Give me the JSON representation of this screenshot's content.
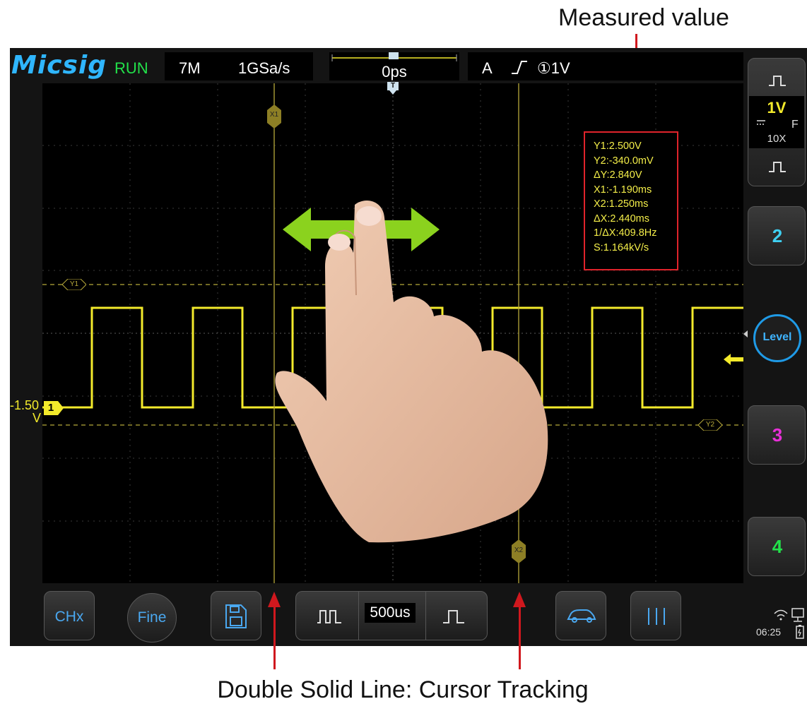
{
  "annotations": {
    "top": "Measured value",
    "bottom": "Double Solid Line: Cursor Tracking"
  },
  "topbar": {
    "brand": "Micsig",
    "run_state": "RUN",
    "memory_depth": "7M",
    "sample_rate": "1GSa/s",
    "time_position": "0ps",
    "trigger_marker": "T",
    "trigger_source": "A",
    "trigger_channel_level": "①1V"
  },
  "cursors": {
    "x1_label": "X1",
    "x2_label": "X2",
    "y1_label": "Y1",
    "y2_label": "Y2"
  },
  "measurements": [
    "Y1:2.500V",
    "Y2:-340.0mV",
    "ΔY:2.840V",
    "X1:-1.190ms",
    "X2:1.250ms",
    "ΔX:2.440ms",
    "1/ΔX:409.8Hz",
    "S:1.164kV/s"
  ],
  "channel1": {
    "number": "1",
    "volts_per_div": "1V",
    "probe": "10X",
    "coupling": "F",
    "offset_line1": "-1.50",
    "offset_line2": "V",
    "color": "#f3ea2b"
  },
  "side_panel": {
    "ch2": "2",
    "ch3": "3",
    "ch4": "4",
    "level": "Level",
    "ch2_color": "#3fd0f2",
    "ch3_color": "#e830d8",
    "ch4_color": "#22e14a"
  },
  "bottombar": {
    "chx": "CHx",
    "fine": "Fine",
    "timebase": "500us",
    "clock": "06:25"
  },
  "icons": [
    "square-wave-icon",
    "save-icon",
    "auto-icon",
    "cursor-icon",
    "wifi-icon",
    "battery-icon",
    "usb-icon"
  ]
}
